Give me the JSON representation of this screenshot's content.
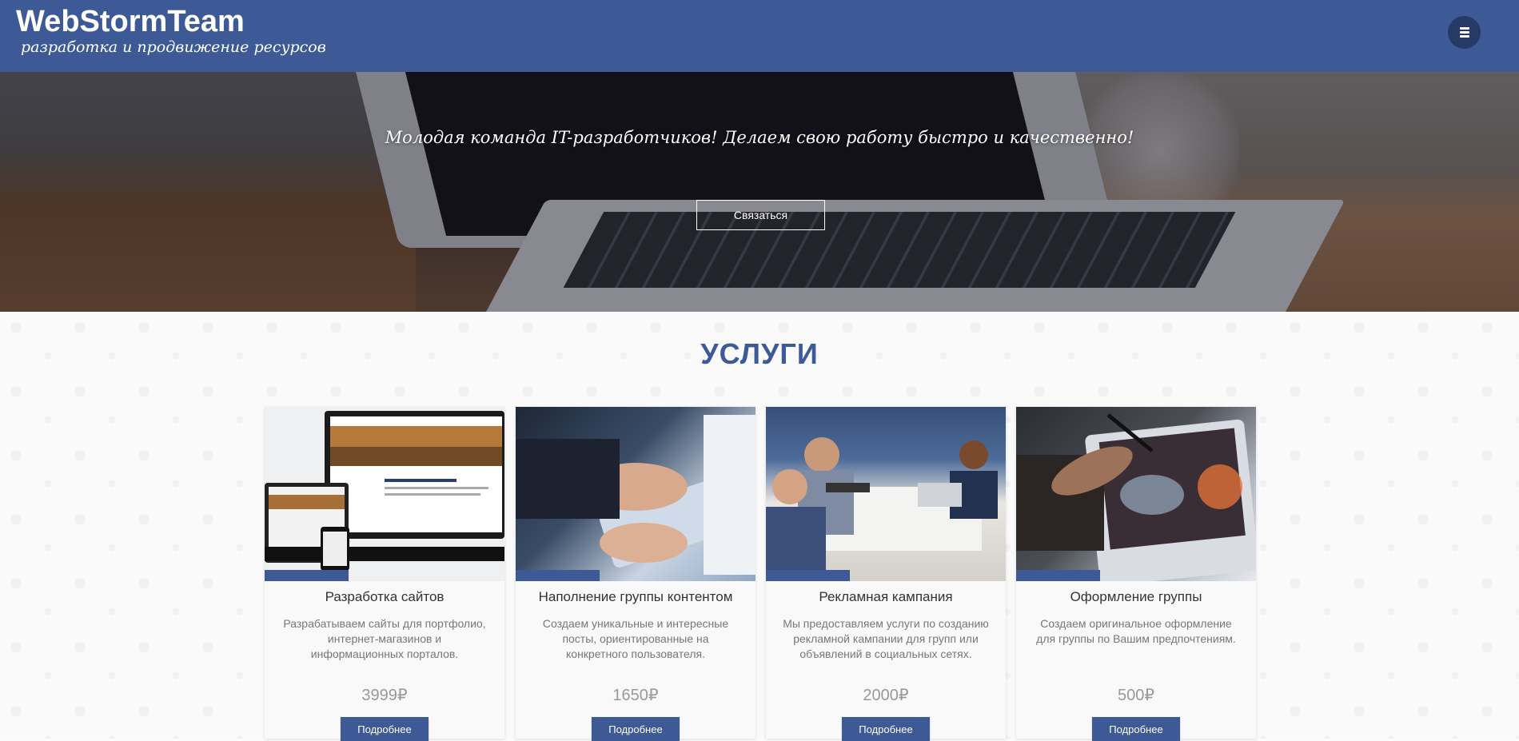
{
  "header": {
    "logo_title": "WebStormTeam",
    "logo_subtitle": "разработка и продвижение ресурсов",
    "menu_icon": "hamburger-icon"
  },
  "hero": {
    "headline": "Молодая команда IT-разработчиков! Делаем свою работу быстро и качественно!",
    "cta_label": "Связаться"
  },
  "services": {
    "title": "УСЛУГИ",
    "cards": [
      {
        "title": "Разработка сайтов",
        "description": "Разрабатываем сайты для портфолио, интернет-магазинов и информационных порталов.",
        "price": "3999₽",
        "button": "Подробнее"
      },
      {
        "title": "Наполнение группы контентом",
        "description": "Создаем уникальные и интересные посты, ориентированные на конкретного пользователя.",
        "price": "1650₽",
        "button": "Подробнее"
      },
      {
        "title": "Рекламная кампания",
        "description": "Мы предоставляем услуги по созданию рекламной кампании для групп или объявлений в социальных сетях.",
        "price": "2000₽",
        "button": "Подробнее"
      },
      {
        "title": "Оформление группы",
        "description": "Создаем оригинальное оформление для группы по Вашим предпочтениям.",
        "price": "500₽",
        "button": "Подробнее"
      }
    ]
  },
  "colors": {
    "brand": "#3e5a96",
    "menu_button": "#263a66"
  }
}
